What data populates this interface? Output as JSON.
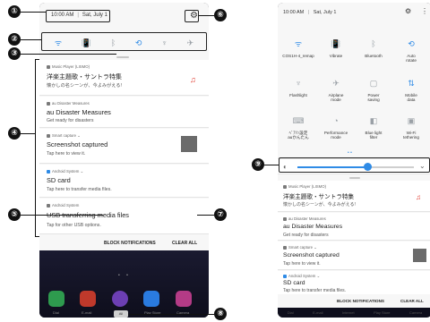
{
  "left_phone": {
    "status": {
      "time": "10:00 AM",
      "date": "Sat, July 1"
    },
    "quick_settings_icons": [
      {
        "icon": "wifi-icon",
        "glyph": "ᯤ",
        "on": true
      },
      {
        "icon": "vibrate-icon",
        "glyph": "📳",
        "on": true
      },
      {
        "icon": "bluetooth-icon",
        "glyph": "ᛒ",
        "on": false
      },
      {
        "icon": "auto-rotate-icon",
        "glyph": "⟲",
        "on": true
      },
      {
        "icon": "flashlight-icon",
        "glyph": "♆",
        "on": false
      },
      {
        "icon": "airplane-icon",
        "glyph": "✈",
        "on": false
      }
    ],
    "notifications": [
      {
        "app": "Music Player (LISMO)",
        "title": "洋楽主題歌・サントラ特集",
        "sub": "懐かしの名シーンが、今よみがえる!"
      },
      {
        "app": "au Disaster Measures",
        "title": "au Disaster Measures",
        "sub": "Get ready for disasters"
      },
      {
        "app": "Smart capture ⌄",
        "title": "Screenshot captured",
        "sub": "Tap here to view it."
      },
      {
        "app": "Android System ⌄",
        "title": "SD card",
        "sub": "Tap here to transfer media files."
      },
      {
        "app": "Android System",
        "title": "USB transferring media files",
        "sub": "Tap for other USB options."
      }
    ],
    "actions": {
      "block": "BLOCK NOTIFICATIONS",
      "clear": "CLEAR ALL"
    },
    "dock": [
      "Dial",
      "E-mail",
      "Internet",
      "Play Store",
      "Camera"
    ],
    "all_label": "All"
  },
  "right_phone": {
    "status": {
      "time": "10:00 AM",
      "date": "Sat, July 1"
    },
    "tiles": [
      {
        "label": "COS1H-4_remap",
        "icon": "wifi-icon",
        "glyph": "ᯤ",
        "on": true
      },
      {
        "label": "Vibrate",
        "icon": "vibrate-icon",
        "glyph": "📳",
        "on": true
      },
      {
        "label": "Bluetooth",
        "icon": "bluetooth-icon",
        "glyph": "ᛒ",
        "on": false
      },
      {
        "label": "Auto\nrotate",
        "icon": "auto-rotate-icon",
        "glyph": "⟲",
        "on": true
      },
      {
        "label": "Flashlight",
        "icon": "flashlight-icon",
        "glyph": "♆",
        "on": false
      },
      {
        "label": "Airplane\nmode",
        "icon": "airplane-icon",
        "glyph": "✈",
        "on": false
      },
      {
        "label": "Power\nsaving",
        "icon": "power-saving-icon",
        "glyph": "▢",
        "on": false
      },
      {
        "label": "Mobile\ndata",
        "icon": "mobile-data-icon",
        "glyph": "⇅",
        "on": true
      },
      {
        "label": "ﾍﾞｱﾘﾝ設定\nauかんたん",
        "icon": "keyboard-icon",
        "glyph": "⌨",
        "on": false
      },
      {
        "label": "Performance\nmode",
        "icon": "performance-icon",
        "glyph": "◔",
        "on": false
      },
      {
        "label": "Blue light\nfilter",
        "icon": "blue-light-icon",
        "glyph": "◧",
        "on": false
      },
      {
        "label": "Wi-Fi\ntethering",
        "icon": "tethering-icon",
        "glyph": "▣",
        "on": false
      }
    ],
    "brightness_level": 0.6,
    "notifications": [
      {
        "app": "Music Player (LISMO)",
        "title": "洋楽主題歌・サントラ特集",
        "sub": "懐かしの名シーンが、今よみがえる!"
      },
      {
        "app": "au Disaster Measures",
        "title": "au Disaster Measures",
        "sub": "Get ready for disasters"
      },
      {
        "app": "Smart capture ⌄",
        "title": "Screenshot captured",
        "sub": "Tap here to view it."
      },
      {
        "app": "Android System ⌄",
        "title": "SD card",
        "sub": "Tap here to transfer media files."
      }
    ],
    "actions": {
      "block": "BLOCK NOTIFICATIONS",
      "clear": "CLEAR ALL"
    },
    "dock": [
      "Dial",
      "E-mail",
      "Internet",
      "Play Store",
      "Camera"
    ]
  },
  "callouts": [
    "①",
    "②",
    "③",
    "④",
    "⑤",
    "⑥",
    "⑦",
    "⑧",
    "⑨"
  ],
  "icons": {
    "gear": "⚙",
    "more": "⋮",
    "brightness": "◐",
    "chevron": "⌄",
    "pager": "• •"
  }
}
